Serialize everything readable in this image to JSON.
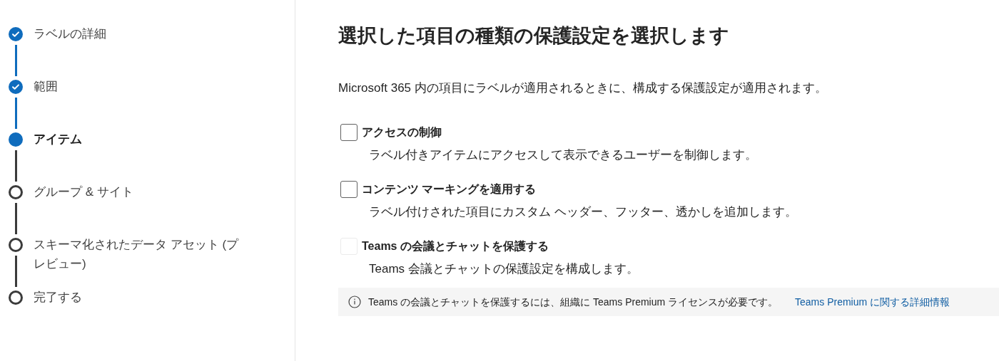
{
  "steps": [
    {
      "label": "ラベルの詳細",
      "completed": true,
      "selected": false
    },
    {
      "label": "範囲",
      "completed": true,
      "selected": false
    },
    {
      "label": "アイテム",
      "completed": false,
      "selected": true
    },
    {
      "label": "グループ & サイト",
      "completed": false,
      "selected": false
    },
    {
      "label": "スキーマ化されたデータ アセット (プレビュー)",
      "completed": false,
      "selected": false
    },
    {
      "label": "完了する",
      "completed": false,
      "selected": false
    }
  ],
  "heading": "選択した項目の種類の保護設定を選択します",
  "description": "Microsoft 365 内の項目にラベルが適用されるときに、構成する保護設定が適用されます。",
  "options": [
    {
      "label": "アクセスの制御",
      "description": "ラベル付きアイテムにアクセスして表示できるユーザーを制御します。",
      "checked": false,
      "disabled": false
    },
    {
      "label": "コンテンツ マーキングを適用する",
      "description": "ラベル付けされた項目にカスタム ヘッダー、フッター、透かしを追加します。",
      "checked": false,
      "disabled": false
    },
    {
      "label": "Teams の会議とチャットを保護する",
      "description": "Teams 会議とチャットの保護設定を構成します。",
      "checked": false,
      "disabled": true
    }
  ],
  "info": {
    "text": "Teams の会議とチャットを保護するには、組織に Teams Premium ライセンスが必要です。",
    "link": "Teams Premium に関する詳細情報"
  }
}
